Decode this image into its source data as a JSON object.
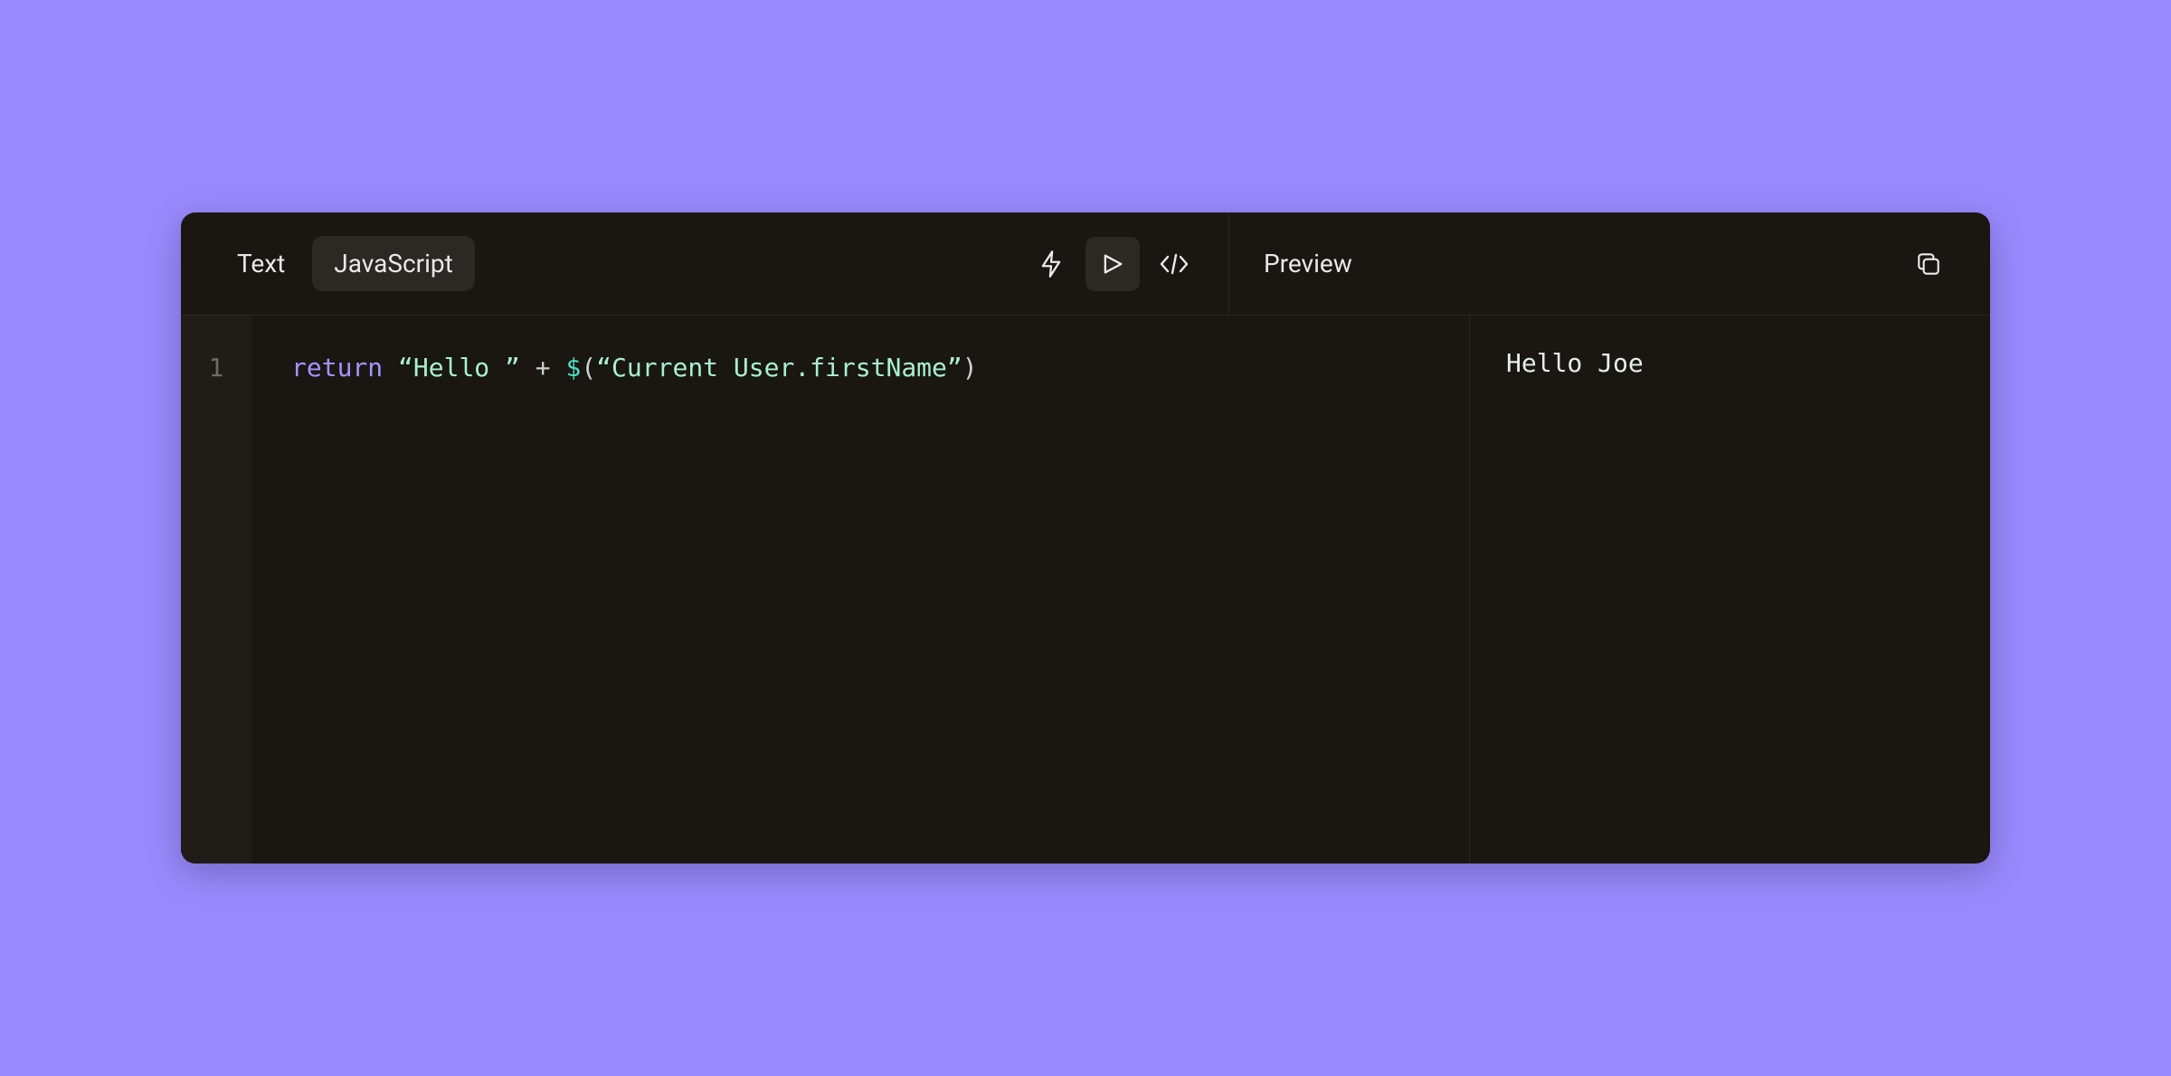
{
  "tabs": {
    "text": "Text",
    "javascript": "JavaScript",
    "active": "javascript"
  },
  "editor": {
    "lines": [
      {
        "n": "1",
        "kw": "return",
        "sp1": " ",
        "str1": "“Hello ”",
        "sp2": " ",
        "op": "+",
        "sp3": " ",
        "fn": "$",
        "lpar": "(",
        "str2": "“Current User.firstName”",
        "rpar": ")"
      }
    ]
  },
  "preview": {
    "label": "Preview",
    "output": "Hello Joe"
  }
}
